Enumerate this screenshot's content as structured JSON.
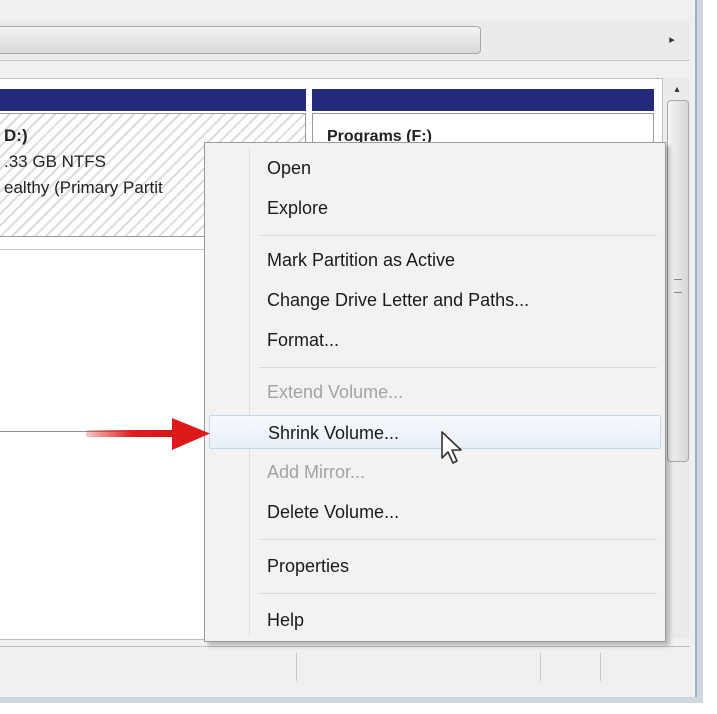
{
  "partitions": {
    "c_name": "D:)",
    "c_size": ".33 GB NTFS",
    "c_status": "ealthy (Primary Partit",
    "f_name": "Programs  (F:)"
  },
  "context_menu": {
    "items": [
      {
        "label": "Open",
        "enabled": true
      },
      {
        "label": "Explore",
        "enabled": true
      },
      {
        "label": "Mark Partition as Active",
        "enabled": true
      },
      {
        "label": "Change Drive Letter and Paths...",
        "enabled": true
      },
      {
        "label": "Format...",
        "enabled": true
      },
      {
        "label": "Extend Volume...",
        "enabled": false
      },
      {
        "label": "Shrink Volume...",
        "enabled": true,
        "highlighted": true
      },
      {
        "label": "Add Mirror...",
        "enabled": false
      },
      {
        "label": "Delete Volume...",
        "enabled": true
      },
      {
        "label": "Properties",
        "enabled": true
      },
      {
        "label": "Help",
        "enabled": true
      }
    ]
  },
  "icons": {
    "scroll_right": "chevron-right-icon",
    "scroll_up": "chevron-up-icon",
    "annotation": "red-arrow-icon",
    "pointer": "mouse-cursor-icon"
  },
  "colors": {
    "partition_header": "#242a7c",
    "annotation_arrow": "#e02020",
    "menu_highlight": "#e8eff8"
  }
}
